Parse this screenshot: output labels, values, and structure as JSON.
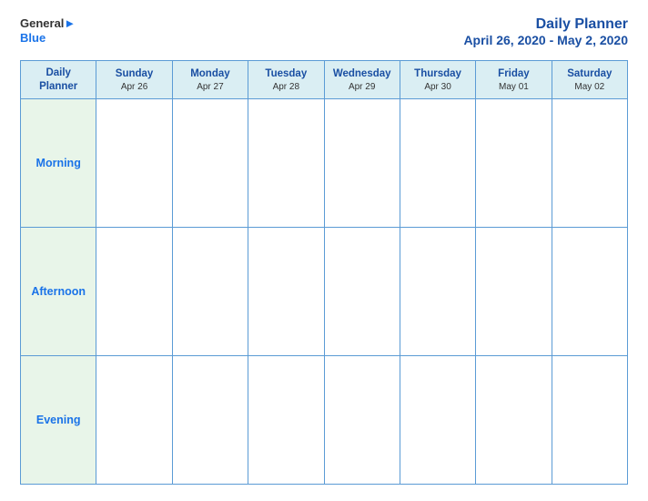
{
  "header": {
    "logo": {
      "brand": "General",
      "accent": "Blue"
    },
    "title": "Daily Planner",
    "date_range": "April 26, 2020 - May 2, 2020"
  },
  "calendar": {
    "col_header_label": "Daily\nPlanner",
    "columns": [
      {
        "day": "Sunday",
        "date": "Apr 26"
      },
      {
        "day": "Monday",
        "date": "Apr 27"
      },
      {
        "day": "Tuesday",
        "date": "Apr 28"
      },
      {
        "day": "Wednesday",
        "date": "Apr 29"
      },
      {
        "day": "Thursday",
        "date": "Apr 30"
      },
      {
        "day": "Friday",
        "date": "May 01"
      },
      {
        "day": "Saturday",
        "date": "May 02"
      }
    ],
    "rows": [
      {
        "label": "Morning"
      },
      {
        "label": "Afternoon"
      },
      {
        "label": "Evening"
      }
    ]
  }
}
